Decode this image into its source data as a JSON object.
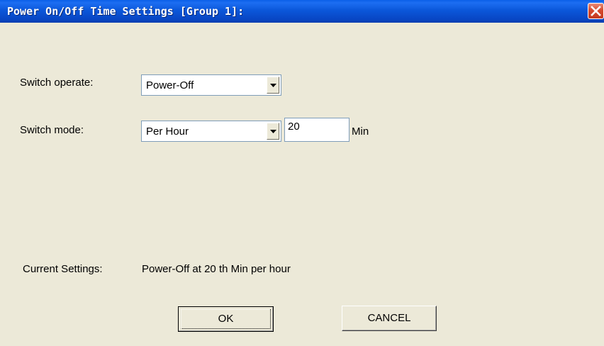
{
  "window": {
    "title": "Power On/Off Time Settings [Group 1]:"
  },
  "form": {
    "switch_operate": {
      "label": "Switch operate:",
      "value": "Power-Off"
    },
    "switch_mode": {
      "label": "Switch  mode:",
      "value": "Per Hour"
    },
    "minutes": {
      "value": "20",
      "unit": "Min"
    },
    "current_settings": {
      "label": "Current Settings:",
      "value": "Power-Off at 20 th Min per hour"
    }
  },
  "buttons": {
    "ok": "OK",
    "cancel": "CANCEL"
  },
  "icons": {
    "close": "close-icon",
    "dropdown": "chevron-down-icon"
  },
  "colors": {
    "titlebar": "#0a57da",
    "close_button": "#d6492d",
    "dialog_background": "#ece9d8"
  }
}
